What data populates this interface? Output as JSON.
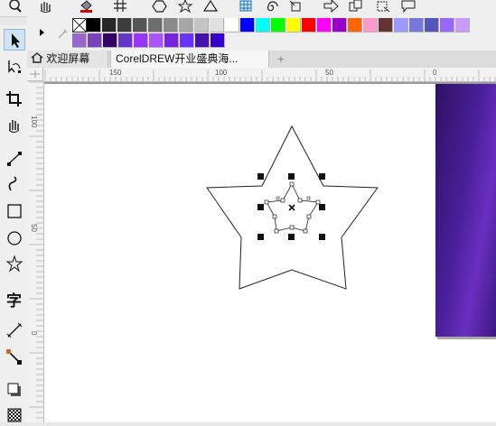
{
  "tabs": [
    {
      "label": "欢迎屏幕",
      "active": false
    },
    {
      "label": "CorelDREW开业盛典海...",
      "active": true
    }
  ],
  "new_tab_label": "+",
  "ruler": {
    "top_labels": [
      "150",
      "100",
      "50",
      "0"
    ],
    "left_labels": [
      "100",
      "50",
      "0"
    ]
  },
  "palette": {
    "row1": [
      "#000000",
      "#262626",
      "#3c3c3c",
      "#555555",
      "#6e6e6e",
      "#8a8a8a",
      "#a6a6a6",
      "#c4c4c4",
      "#e0e0e0",
      "#ffffff",
      "#0000ff",
      "#00ffff",
      "#00ff00",
      "#ffff00",
      "#ff0000",
      "#ff00ff",
      "#9900cc",
      "#ff6600",
      "#ff99cc",
      "#663333",
      "#9999ff",
      "#7777dd",
      "#5555bb",
      "#9966ff",
      "#cc99ff"
    ],
    "row2": [
      "#9966cc",
      "#7744bb",
      "#330066",
      "#6633cc",
      "#9933ff",
      "#aa55ff",
      "#7722dd",
      "#6633ff",
      "#4411aa",
      "#3300cc"
    ]
  },
  "icons": {
    "top": [
      "zoom-icon",
      "pan-hand-icon",
      "fill-bucket-icon",
      "grid-icon",
      "hexagon-icon",
      "star-icon",
      "spiral-icon",
      "table-icon",
      "spiral-tool-icon",
      "transform-icon",
      "arrow-icon",
      "copy-icon",
      "callout-icon"
    ],
    "left": [
      "pick-tool-icon",
      "shape-tool-icon",
      "crop-tool-icon",
      "pan-tool-icon",
      "freehand-tool-icon",
      "artistic-media-icon",
      "rectangle-tool-icon",
      "ellipse-tool-icon",
      "star-tool-icon",
      "text-tool-icon",
      "dimension-tool-icon",
      "connector-tool-icon",
      "drop-shadow-tool-icon",
      "interactive-fill-icon"
    ]
  },
  "text_tool_glyph": "字",
  "colors": {
    "gradient_start": "#2e1262",
    "gradient_end": "#6a2fc0",
    "accent": "#3b1680"
  }
}
